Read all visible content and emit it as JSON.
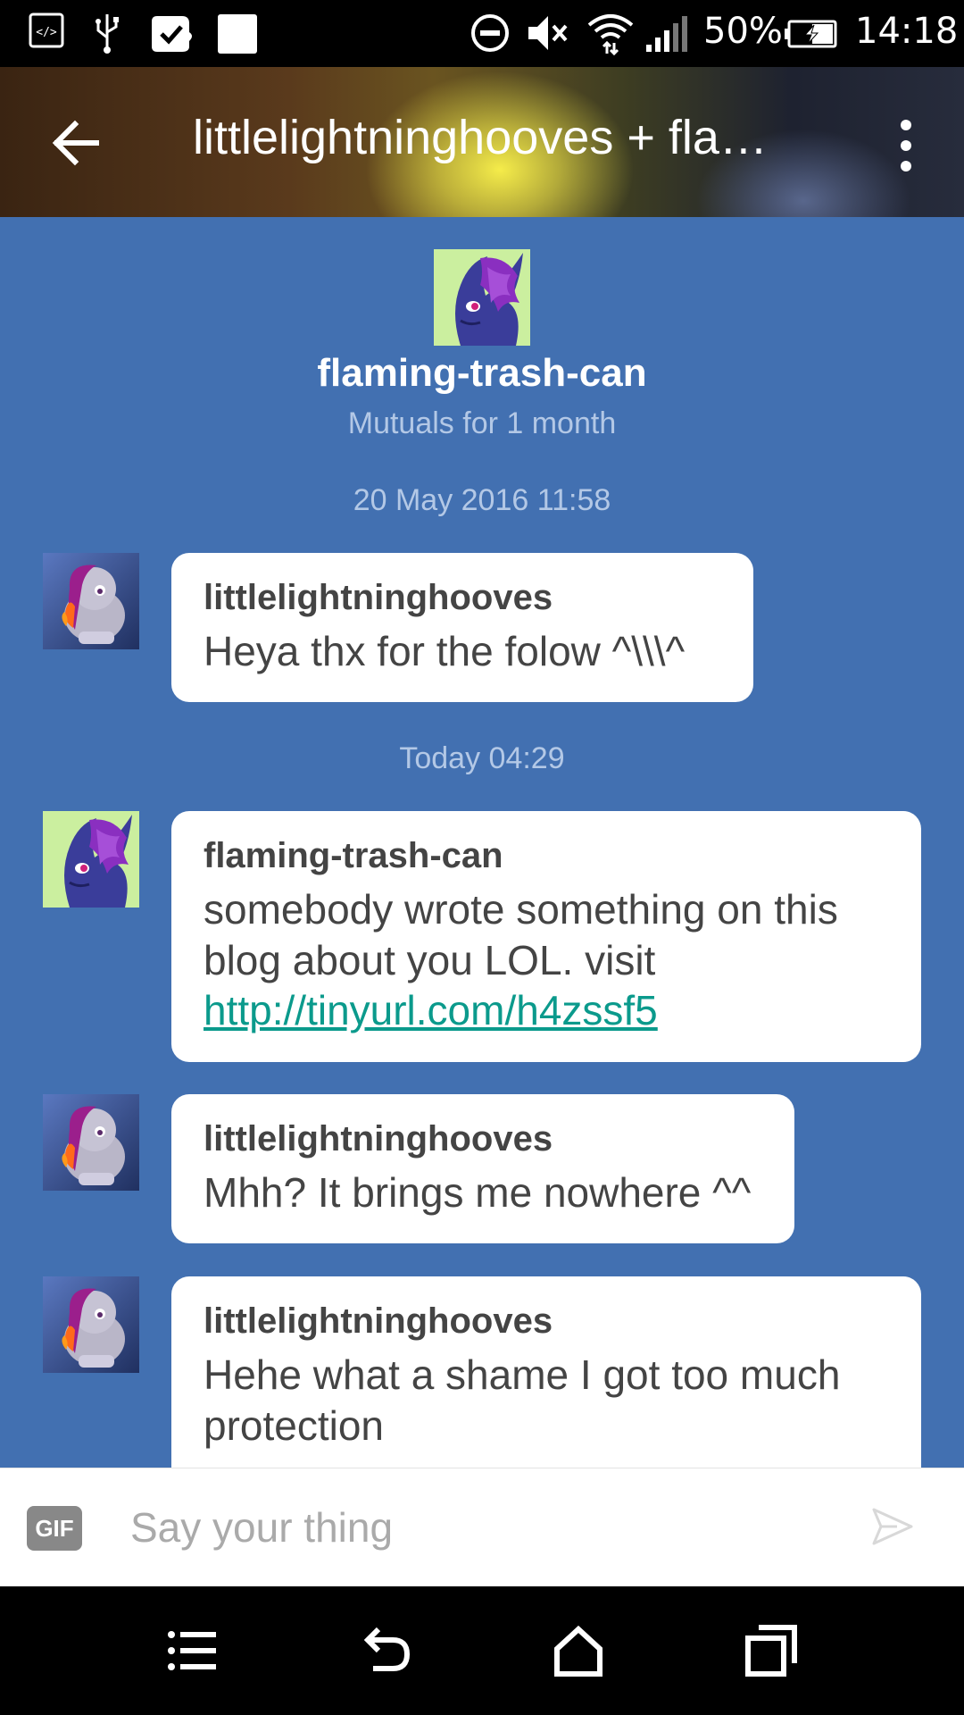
{
  "status_bar": {
    "battery": "50%",
    "time": "14:18",
    "icons": [
      "developer-icon",
      "usb-icon",
      "check-icon",
      "notification-square-icon",
      "do-not-disturb-icon",
      "mute-icon",
      "wifi-icon",
      "signal-icon",
      "battery-charging-icon"
    ]
  },
  "app_bar": {
    "title": "littlelightninghooves + flaming-trash-can",
    "back_icon": "back-arrow-icon",
    "more_icon": "more-vertical-icon"
  },
  "conversation_header": {
    "name": "flaming-trash-can",
    "subtitle": "Mutuals for 1 month"
  },
  "messages": [
    {
      "type": "timestamp",
      "text": "20 May 2016 11:58"
    },
    {
      "type": "message",
      "sender": "littlelightninghooves",
      "text": "Heya thx for the folow ^\\\\\\^"
    },
    {
      "type": "timestamp",
      "text": "Today 04:29"
    },
    {
      "type": "message",
      "sender": "flaming-trash-can",
      "text": "somebody wrote something on this blog about you LOL. visit ",
      "link": "http://tinyurl.com/h4zssf5"
    },
    {
      "type": "message",
      "sender": "littlelightninghooves",
      "text": "Mhh? It brings me nowhere ^^"
    },
    {
      "type": "message",
      "sender": "littlelightninghooves",
      "text": "Hehe what a shame I got too much protection"
    }
  ],
  "composer": {
    "gif_label": "GIF",
    "placeholder": "Say your thing",
    "send_icon": "send-icon"
  },
  "nav_bar": {
    "icons": [
      "menu-icon",
      "back-icon",
      "home-icon",
      "recents-icon"
    ]
  },
  "colors": {
    "background": "#4270b1",
    "bubble": "#ffffff",
    "link": "#0b9a8c",
    "muted_text": "#b3c8e6"
  }
}
